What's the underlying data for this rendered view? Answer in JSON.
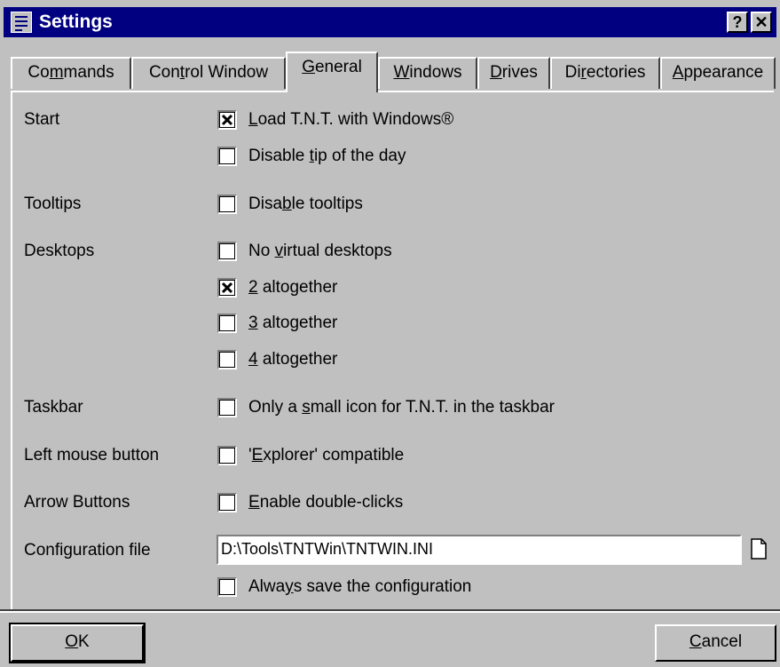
{
  "window": {
    "title": "Settings",
    "help_label": "?",
    "close_label": "✕"
  },
  "tabs": [
    {
      "pre": "Co",
      "key": "m",
      "post": "mands"
    },
    {
      "pre": "Con",
      "key": "t",
      "post": "rol Window"
    },
    {
      "pre": "",
      "key": "G",
      "post": "eneral"
    },
    {
      "pre": "",
      "key": "W",
      "post": "indows"
    },
    {
      "pre": "",
      "key": "D",
      "post": "rives"
    },
    {
      "pre": "Di",
      "key": "r",
      "post": "ectories"
    },
    {
      "pre": "",
      "key": "A",
      "post": "ppearance"
    }
  ],
  "active_tab": "General",
  "sections": {
    "start": "Start",
    "tooltips": "Tooltips",
    "desktops": "Desktops",
    "taskbar": "Taskbar",
    "left_mouse": "Left mouse button",
    "arrow_buttons": "Arrow Buttons",
    "config_file": "Configuration file"
  },
  "options": {
    "load_tnt": {
      "pre": "",
      "key": "L",
      "post": "oad T.N.T. with Windows®",
      "checked": true
    },
    "disable_tip": {
      "pre": "Disable ",
      "key": "t",
      "post": "ip of the day",
      "checked": false
    },
    "disable_tooltips": {
      "pre": "Disa",
      "key": "b",
      "post": "le tooltips",
      "checked": false
    },
    "no_virtual": {
      "pre": "No ",
      "key": "v",
      "post": "irtual desktops",
      "checked": false
    },
    "two_altogether": {
      "pre": "",
      "key": "2",
      "post": " altogether",
      "checked": true
    },
    "three_altogether": {
      "pre": "",
      "key": "3",
      "post": " altogether",
      "checked": false
    },
    "four_altogether": {
      "pre": "",
      "key": "4",
      "post": " altogether",
      "checked": false
    },
    "small_icon": {
      "pre": "Only a ",
      "key": "s",
      "post": "mall icon for T.N.T. in the taskbar",
      "checked": false
    },
    "explorer_compatible": {
      "pre": "'",
      "key": "E",
      "post": "xplorer' compatible",
      "checked": false
    },
    "double_clicks": {
      "pre": "",
      "key": "E",
      "post": "nable double-clicks",
      "checked": false
    },
    "always_save": {
      "pre": "Alwa",
      "key": "y",
      "post": "s save the configuration",
      "checked": false
    }
  },
  "config_path": "D:\\Tools\\TNTWin\\TNTWIN.INI",
  "buttons": {
    "ok": {
      "pre": "",
      "key": "O",
      "post": "K"
    },
    "cancel": {
      "pre": "",
      "key": "C",
      "post": "ancel"
    }
  }
}
